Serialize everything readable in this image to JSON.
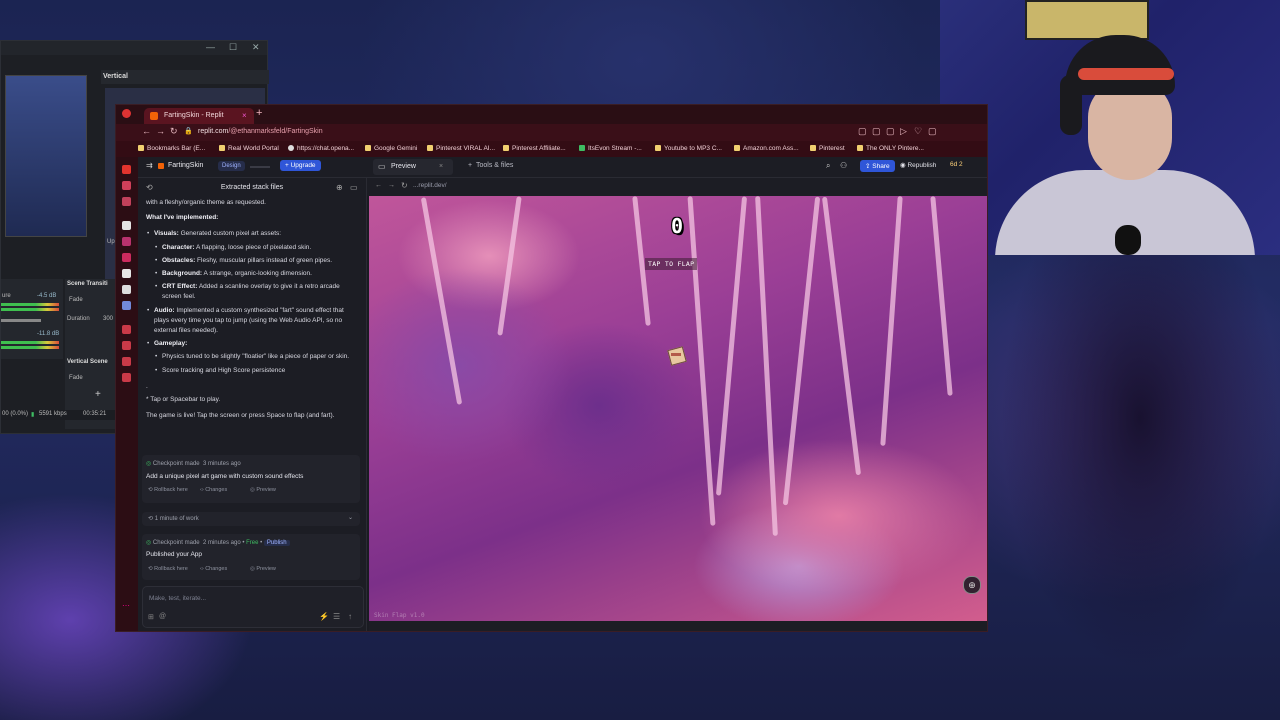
{
  "obs": {
    "vertical_title": "Vertical",
    "scene_transitions": "Scene Transiti",
    "fade": "Fade",
    "duration_label": "Duration",
    "duration_value": "300",
    "vertical_scene": "Vertical Scene",
    "fade2": "Fade",
    "db1": "-4.5 dB",
    "db2": "-11.8 dB",
    "mixer_label": "ure",
    "status_frames": "00 (0.0%)",
    "status_kbps": "5591 kbps",
    "status_time": "00:35:21",
    "up_label": "Up"
  },
  "browser": {
    "tab_title": "FartingSkin - Replit",
    "url_host": "replit.com",
    "url_path": "/@ethanmarksfeld/FartingSkin",
    "bookmarks": [
      "Bookmarks Bar (E...",
      "Real World Portal",
      "https://chat.opena...",
      "Google Gemini",
      "Pinterest VIRAL AI...",
      "Pinterest Affiliate...",
      "ItsEvon Stream -...",
      "Youtube to MP3 C...",
      "Amazon.com Ass...",
      "Pinterest",
      "The ONLY Pintere..."
    ]
  },
  "replit": {
    "repl_name": "FartingSkin",
    "design_badge": "Design",
    "upgrade": "Upgrade",
    "preview_tab": "Preview",
    "tools_tab": "Tools & files",
    "share": "Share",
    "republish": "Republish",
    "count": "6d 2",
    "preview_url": "...replit.dev/"
  },
  "chat": {
    "header": "Extracted stack files",
    "intro": "with a fleshy/organic theme as requested.",
    "implemented_heading": "What I've implemented:",
    "visuals_label": "Visuals:",
    "visuals_text": " Generated custom pixel art assets:",
    "character_label": "Character:",
    "character_text": " A flapping, loose piece of pixelated skin.",
    "obstacles_label": "Obstacles:",
    "obstacles_text": " Fleshy, muscular pillars instead of green pipes.",
    "background_label": "Background:",
    "background_text": " A strange, organic-looking dimension.",
    "crt_label": "CRT Effect:",
    "crt_text": " Added a scanline overlay to give it a retro arcade screen feel.",
    "audio_label": "Audio:",
    "audio_text": " Implemented a custom synthesized \"fart\" sound effect that plays every time you tap to jump (using the Web Audio API, so no external files needed).",
    "gameplay_label": "Gameplay:",
    "physics_text": "Physics tuned to be slightly \"floatier\" like a piece of paper or skin.",
    "score_text": "Score tracking and High Score persistence",
    "dot": ".",
    "tap_line": "* Tap or Spacebar to play.",
    "live_line": "The game is live! Tap the screen or press Space to flap (and fart).",
    "checkpoint1_head": "Checkpoint made",
    "checkpoint1_time": "3 minutes ago",
    "checkpoint1_title": "Add a unique pixel art game with custom sound effects",
    "rollback": "Rollback here",
    "changes": "Changes",
    "preview": "Preview",
    "work_time": "1 minute of work",
    "checkpoint2_head": "Checkpoint made",
    "checkpoint2_time": "2 minutes ago",
    "free": "Free",
    "publish": "Publish",
    "checkpoint2_title": "Published your App",
    "input_placeholder": "Make, test, iterate..."
  },
  "game": {
    "score": "0",
    "prompt": "TAP TO FLAP",
    "version": "Skin Flap v1.0"
  }
}
